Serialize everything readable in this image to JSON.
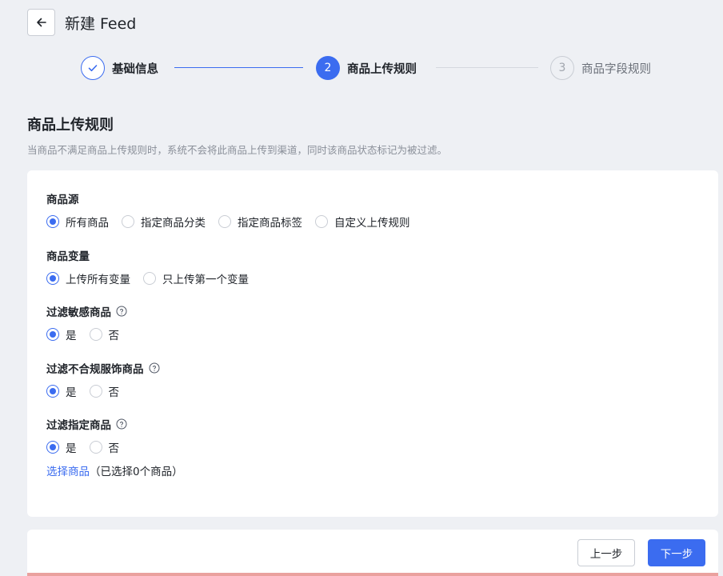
{
  "header": {
    "title": "新建 Feed",
    "back_icon": "arrow-left-icon"
  },
  "steps": [
    {
      "number": "",
      "label": "基础信息",
      "status": "done"
    },
    {
      "number": "2",
      "label": "商品上传规则",
      "status": "active"
    },
    {
      "number": "3",
      "label": "商品字段规则",
      "status": "pending"
    }
  ],
  "section": {
    "title": "商品上传规则",
    "description": "当商品不满足商品上传规则时，系统不会将此商品上传到渠道，同时该商品状态标记为被过滤。"
  },
  "groups": [
    {
      "label": "商品源",
      "options": [
        "所有商品",
        "指定商品分类",
        "指定商品标签",
        "自定义上传规则"
      ],
      "selected": "所有商品"
    },
    {
      "label": "商品变量",
      "options": [
        "上传所有变量",
        "只上传第一个变量"
      ],
      "selected": "上传所有变量"
    },
    {
      "label": "过滤敏感商品",
      "options": [
        "是",
        "否"
      ],
      "selected": "是"
    },
    {
      "label": "过滤不合规服饰商品",
      "options": [
        "是",
        "否"
      ],
      "selected": "是"
    },
    {
      "label": "过滤指定商品",
      "options": [
        "是",
        "否"
      ],
      "selected": "是"
    }
  ],
  "select_products": {
    "link": "选择商品",
    "count": "（已选择0个商品）"
  },
  "footer": {
    "prev": "上一步",
    "next": "下一步"
  },
  "colors": {
    "primary": "#3b6cf0",
    "background": "#eef0f4"
  }
}
